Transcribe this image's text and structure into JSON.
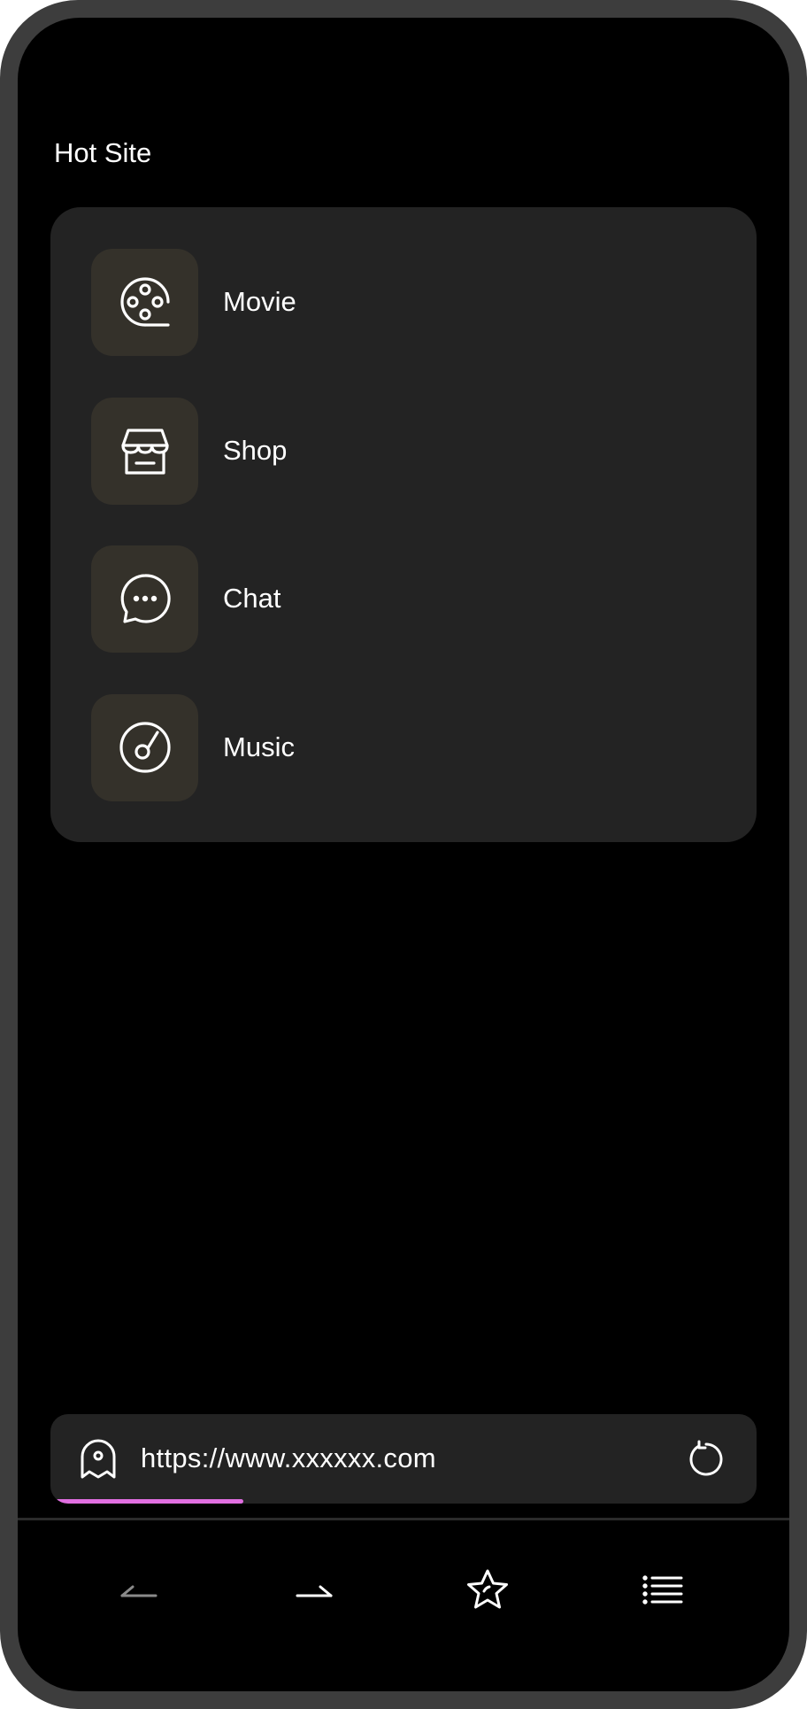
{
  "hot_site": {
    "title": "Hot Site",
    "items": [
      {
        "label": "Movie",
        "icon": "film-reel-icon"
      },
      {
        "label": "Shop",
        "icon": "storefront-icon"
      },
      {
        "label": "Chat",
        "icon": "chat-bubble-icon"
      },
      {
        "label": "Music",
        "icon": "music-disc-icon"
      }
    ]
  },
  "address_bar": {
    "url": "https://www.xxxxxx.com",
    "site_icon": "ghost-icon",
    "reload_icon": "reload-icon",
    "load_progress": 0.27
  },
  "bottom_nav": {
    "back_icon": "back-arrow-icon",
    "forward_icon": "forward-arrow-icon",
    "bookmark_icon": "star-icon",
    "menu_icon": "menu-list-icon"
  },
  "colors": {
    "background": "#000000",
    "card": "#232323",
    "icon_tile": "#34312a",
    "progress": "#e06ee0",
    "frame": "#3d3d3d"
  }
}
